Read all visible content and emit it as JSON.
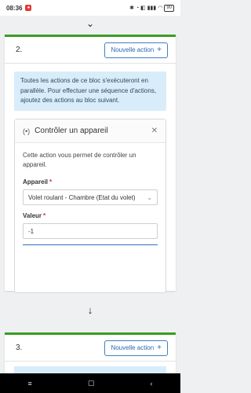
{
  "status_bar": {
    "time": "08:36",
    "right_icons": "✱ ◔ ◧ ▮▮▮ ◠",
    "battery": "90"
  },
  "arrows": {
    "top": "⌄",
    "middle": "↓"
  },
  "blocks": [
    {
      "number": "2.",
      "new_action_label": "Nouvelle action",
      "info_text": "Toutes les actions de ce bloc s'exécuteront en parallèle. Pour effectuer une séquence d'actions, ajoutez des actions au bloc suivant.",
      "action": {
        "title": "Contrôler un appareil",
        "description": "Cette action vous permet de contrôler un appareil.",
        "device_label": "Appareil",
        "device_value": "Volet roulant - Chambre (Etat du volet)",
        "value_label": "Valeur",
        "value_input": "-1"
      }
    },
    {
      "number": "3.",
      "new_action_label": "Nouvelle action"
    }
  ],
  "nav": {
    "menu": "≡",
    "home": "▢",
    "back": "‹"
  },
  "colors": {
    "accent_green": "#3a9d23",
    "primary_blue": "#2a66b3",
    "info_bg": "#d9ecf9",
    "required_red": "#d32f2f"
  }
}
